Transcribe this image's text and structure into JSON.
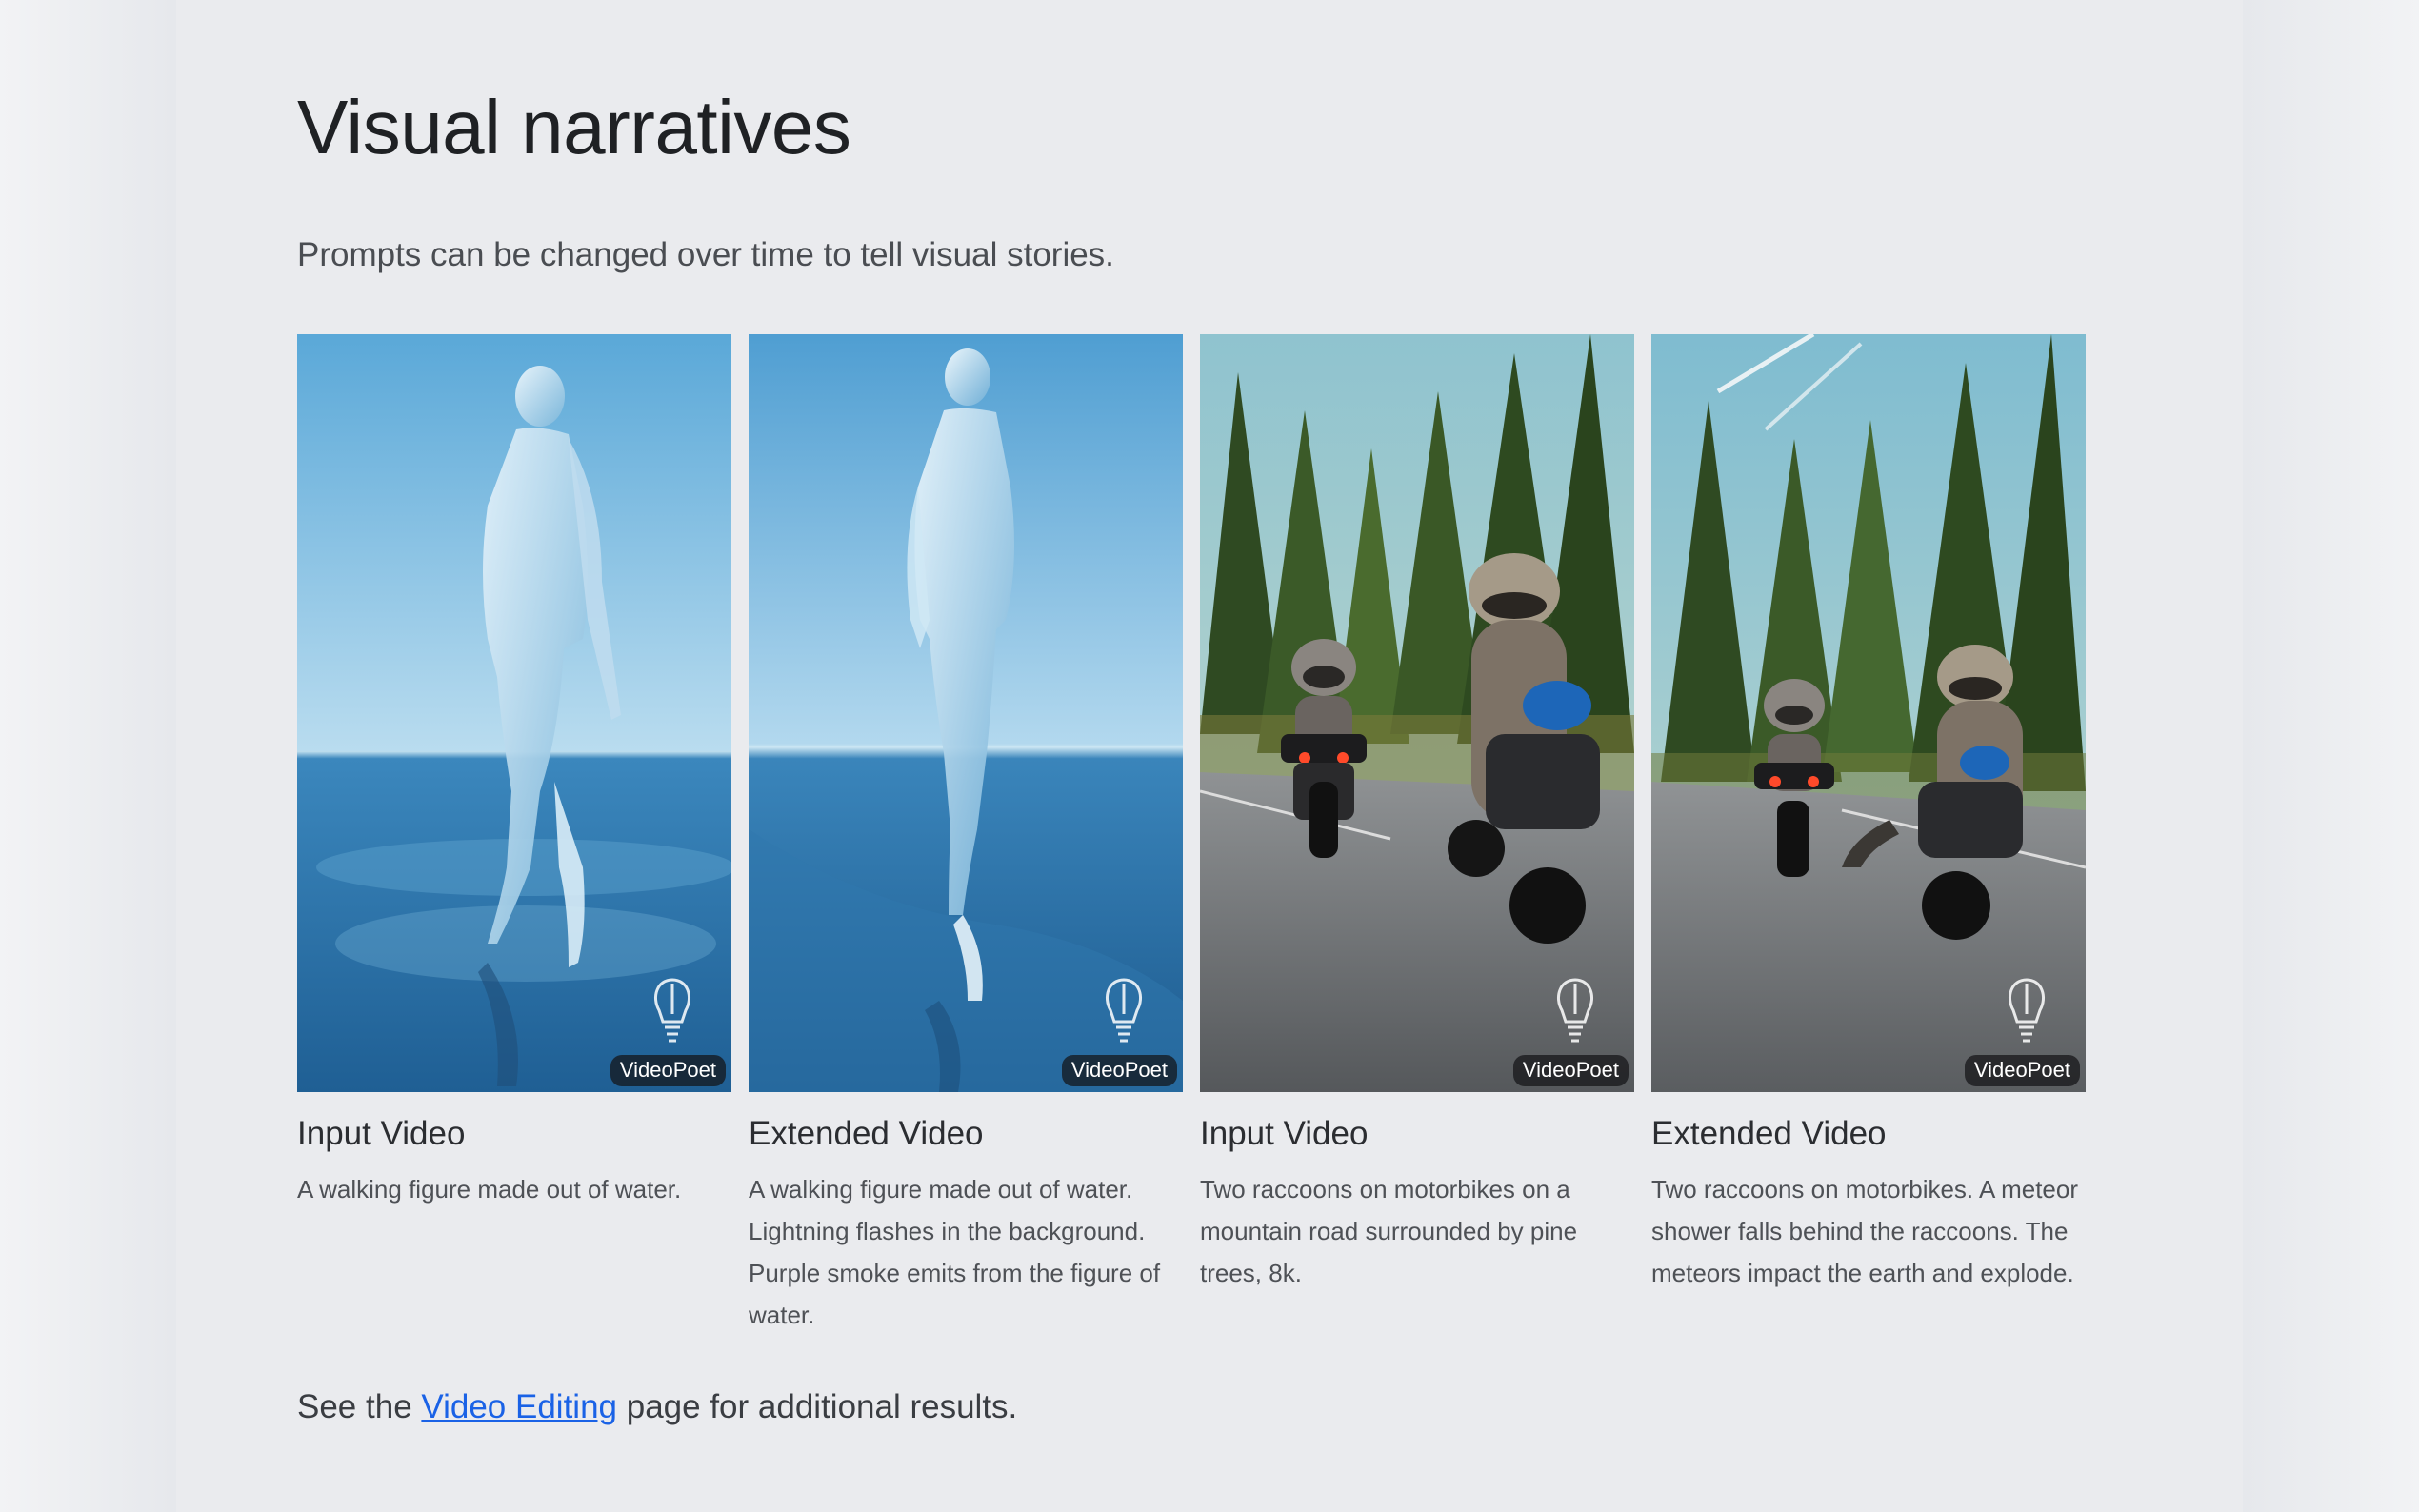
{
  "section": {
    "title": "Visual narratives",
    "subtitle": "Prompts can be changed over time to tell visual stories."
  },
  "cards": [
    {
      "label": "Input Video",
      "description": "A walking figure made out of water.",
      "badge": "VideoPoet",
      "thumbnail": "walking-water-figure"
    },
    {
      "label": "Extended Video",
      "description": "A walking figure made out of water. Lightning flashes in the background. Purple smoke emits from the figure of water.",
      "badge": "VideoPoet",
      "thumbnail": "walking-water-figure-extended"
    },
    {
      "label": "Input Video",
      "description": "Two raccoons on motorbikes on a mountain road surrounded by pine trees, 8k.",
      "badge": "VideoPoet",
      "thumbnail": "raccoons-motorbikes"
    },
    {
      "label": "Extended Video",
      "description": "Two raccoons on motorbikes. A meteor shower falls behind the raccoons. The meteors impact the earth and explode.",
      "badge": "VideoPoet",
      "thumbnail": "raccoons-motorbikes-meteor"
    }
  ],
  "footer": {
    "prefix": "See the",
    "link_text": "Video Editing",
    "suffix": "page for additional results."
  },
  "colors": {
    "page_background": "#eaebee",
    "link": "#1a62e6",
    "title": "#1f2124"
  }
}
